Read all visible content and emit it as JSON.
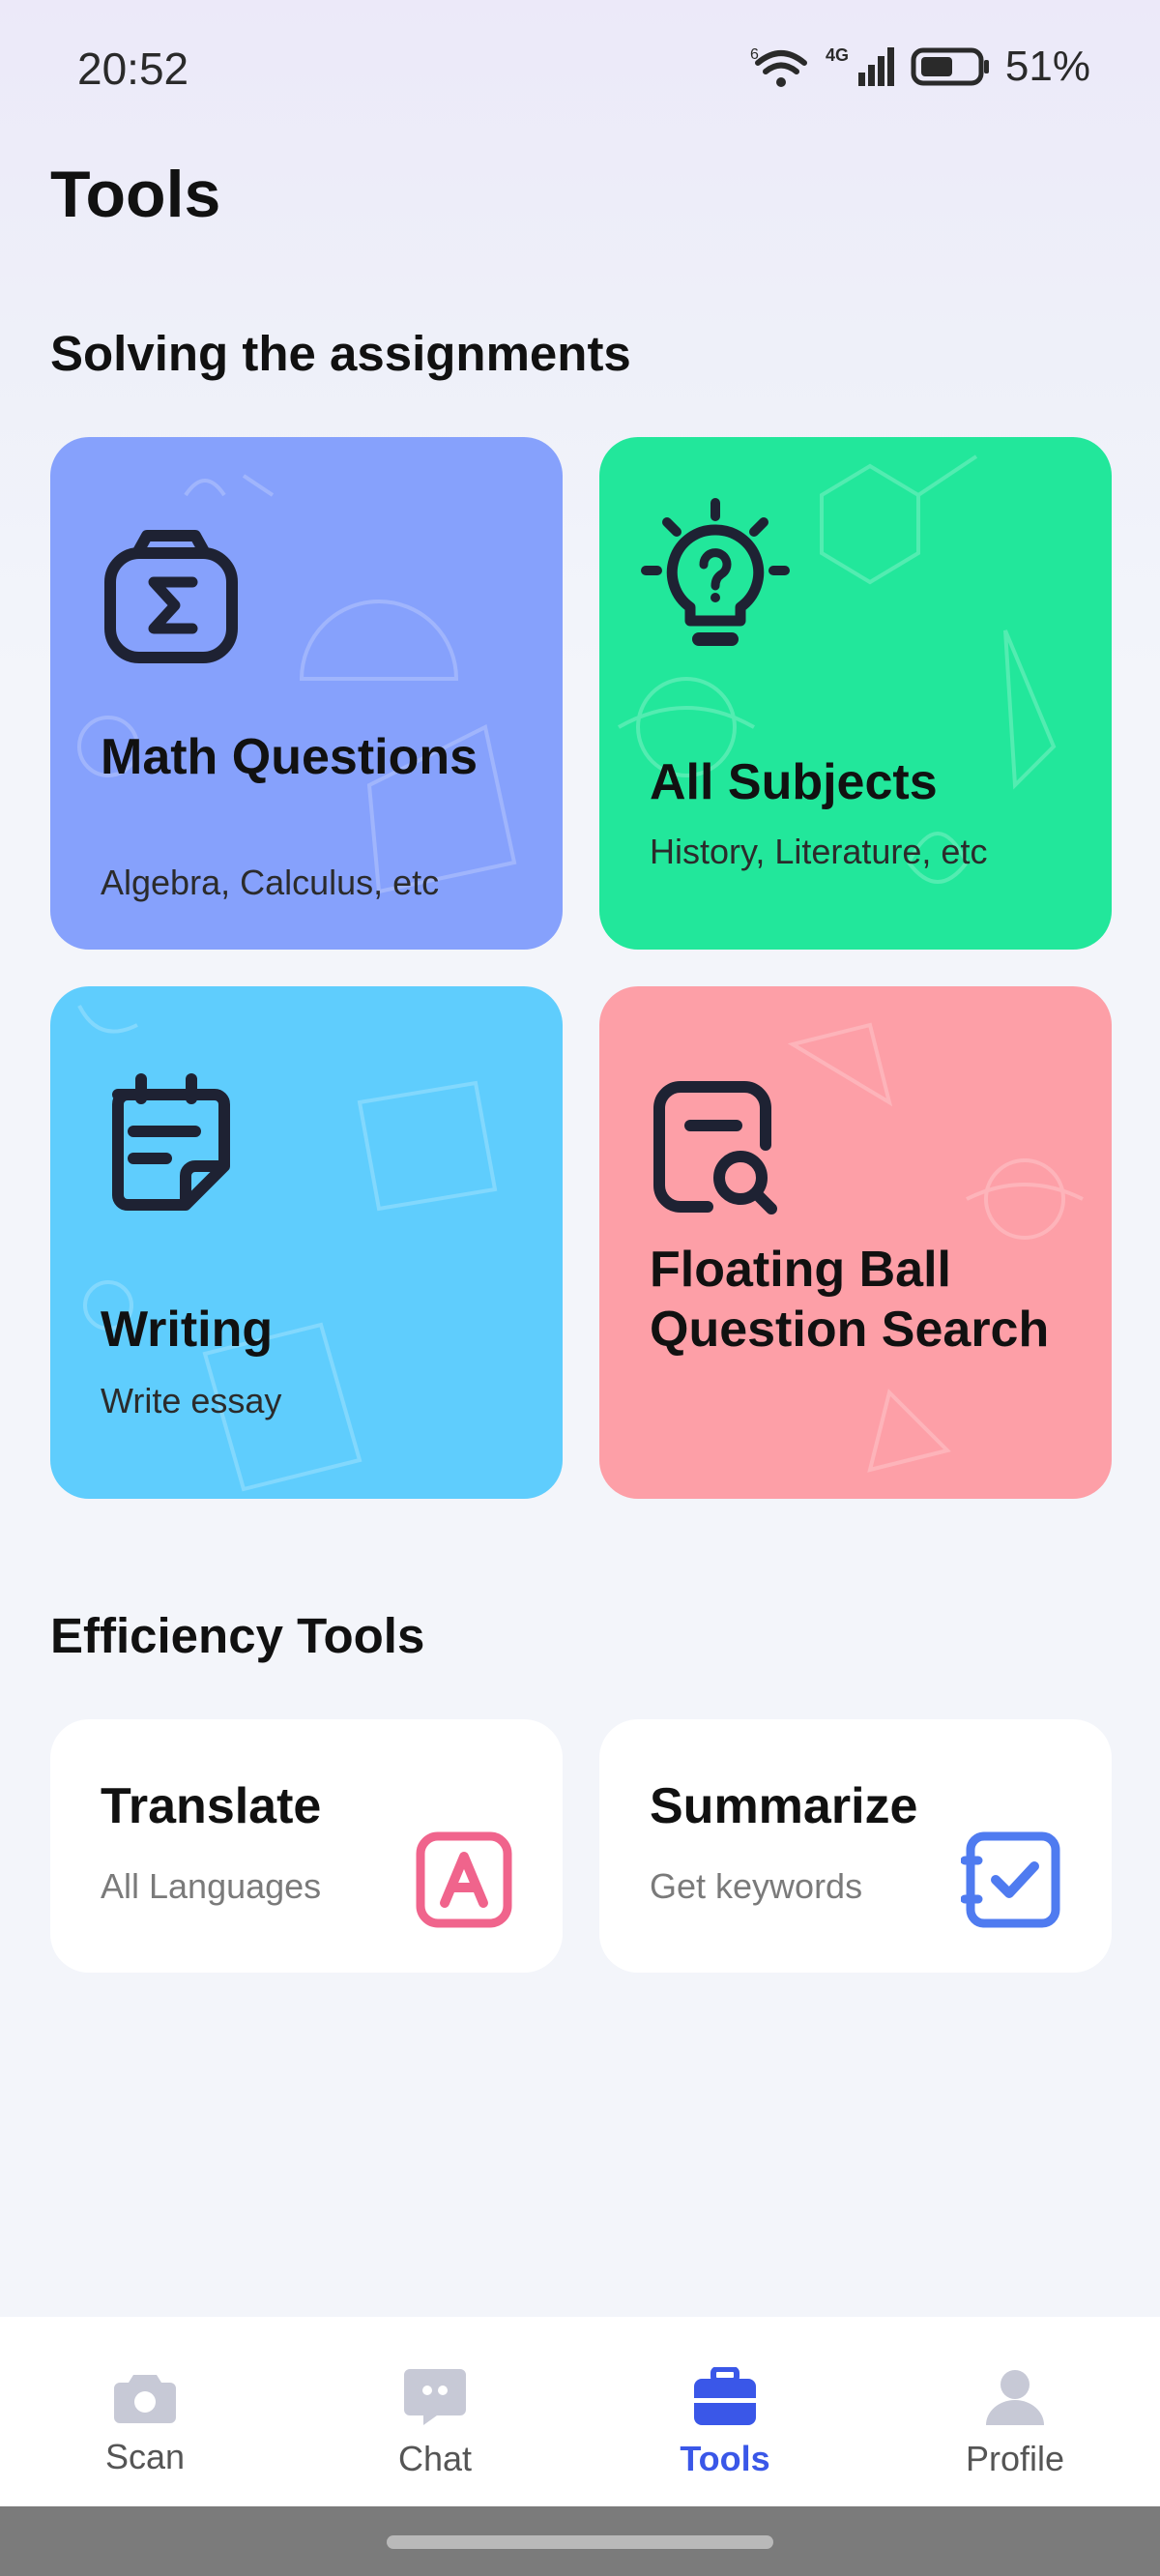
{
  "status_bar": {
    "time": "20:52",
    "battery_percent": "51%",
    "network_label": "4G",
    "wifi_badge": "6"
  },
  "page": {
    "title": "Tools"
  },
  "assignments": {
    "section_title": "Solving the assignments",
    "cards": [
      {
        "title": "Math Questions",
        "subtitle": "Algebra, Calculus, etc",
        "icon": "sigma-camera-icon",
        "color": "#86a1fc"
      },
      {
        "title": "All Subjects",
        "subtitle": "History, Literature, etc",
        "icon": "lightbulb-question-icon",
        "color": "#22e79b"
      },
      {
        "title": "Writing",
        "subtitle": "Write essay",
        "icon": "notepad-icon",
        "color": "#5fcdfd"
      },
      {
        "title": "Floating Ball Question Search",
        "icon": "document-search-icon",
        "color": "#fd9fa7"
      }
    ]
  },
  "efficiency": {
    "section_title": "Efficiency Tools",
    "tools": [
      {
        "title": "Translate",
        "subtitle": "All Languages",
        "icon": "translate-icon",
        "color": "#f0648c"
      },
      {
        "title": "Summarize",
        "subtitle": "Get keywords",
        "icon": "summarize-check-icon",
        "color": "#4f7bf0"
      }
    ]
  },
  "bottom_nav": {
    "items": [
      {
        "label": "Scan",
        "icon": "camera-icon"
      },
      {
        "label": "Chat",
        "icon": "chat-bubble-icon"
      },
      {
        "label": "Tools",
        "icon": "toolbox-icon",
        "active": true
      },
      {
        "label": "Profile",
        "icon": "person-icon"
      }
    ],
    "active_color": "#3a57e8",
    "inactive_color": "#c7c9d6"
  }
}
